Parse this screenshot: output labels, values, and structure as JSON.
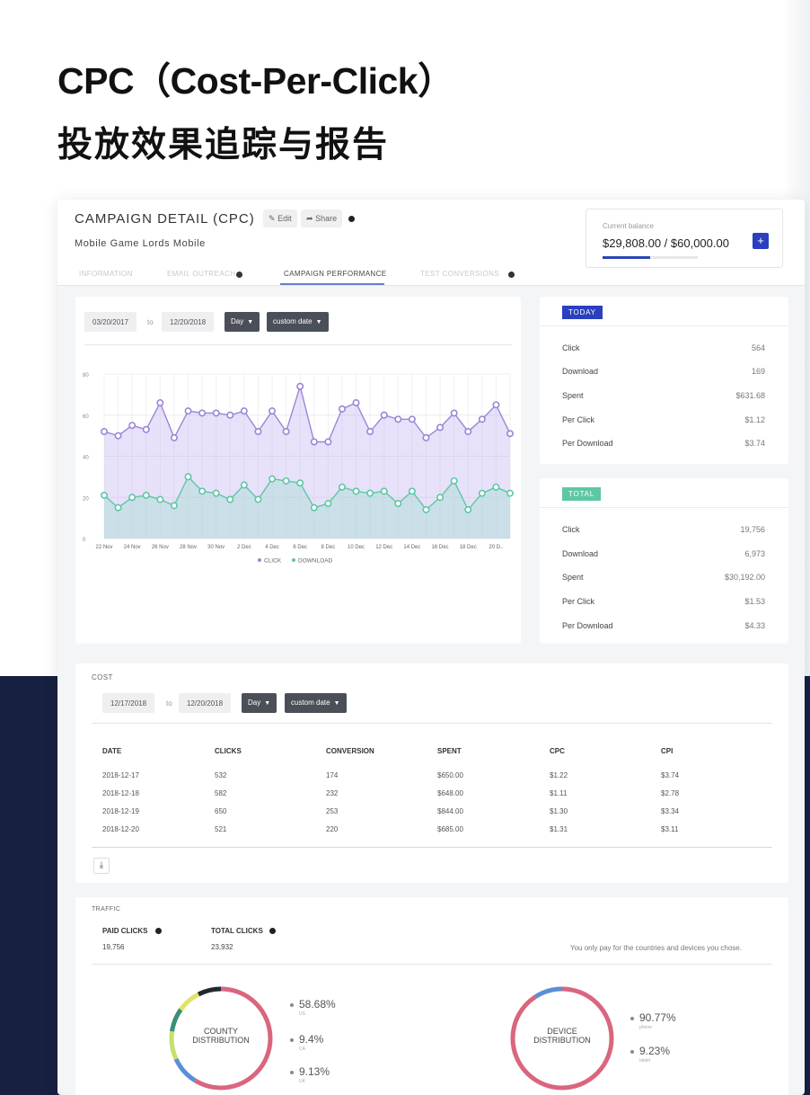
{
  "hero": {
    "title": "CPC（Cost-Per-Click）",
    "subtitle": "投放效果追踪与报告"
  },
  "campaign": {
    "title": "CAMPAIGN DETAIL (CPC)",
    "edit_label": "Edit",
    "share_label": "Share",
    "game_name": "Mobile Game Lords Mobile",
    "tabs": [
      "INFORMATION",
      "EMAIL OUTREACH",
      "CAMPAIGN PERFORMANCE",
      "TEST CONVERSIONS"
    ],
    "active_tab": "CAMPAIGN PERFORMANCE"
  },
  "balance": {
    "label": "Current balance",
    "value": "$29,808.00 / $60,000.00",
    "progress": 0.4968,
    "add_label": "+"
  },
  "performance": {
    "date_from": "03/20/2017",
    "to_label": "to",
    "date_to": "12/20/2018",
    "interval": "Day",
    "range": "custom date"
  },
  "chart_data": {
    "type": "line",
    "x": [
      "22 Nov",
      "",
      "24 Nov",
      "",
      "26 Nov",
      "",
      "28 Nov",
      "",
      "30 Nov",
      "",
      "2 Dec",
      "",
      "4 Dec",
      "",
      "6 Dec",
      "",
      "8 Dec",
      "",
      "10 Dec",
      "",
      "12 Dec",
      "",
      "14 Dec",
      "",
      "16 Dec",
      "",
      "18 Dec",
      "",
      "20 D..",
      ""
    ],
    "x_tick_labels": [
      "22 Nov",
      "24 Nov",
      "26 Nov",
      "28 Nov",
      "30 Nov",
      "2 Dec",
      "4 Dec",
      "6 Dec",
      "8 Dec",
      "10 Dec",
      "12 Dec",
      "14 Dec",
      "16 Dec",
      "18 Dec",
      "20 D.."
    ],
    "y_ticks": [
      0,
      20,
      40,
      60,
      80
    ],
    "ylim": [
      0,
      80
    ],
    "series": [
      {
        "name": "CLICK",
        "color": "#9b86d6",
        "values": [
          52,
          50,
          55,
          53,
          66,
          49,
          62,
          61,
          61,
          60,
          62,
          52,
          62,
          52,
          74,
          47,
          47,
          63,
          66,
          52,
          60,
          58,
          58,
          49,
          54,
          61,
          52,
          58,
          65,
          51
        ]
      },
      {
        "name": "DOWNLOAD",
        "color": "#5dc8a4",
        "values": [
          21,
          15,
          20,
          21,
          19,
          16,
          30,
          23,
          22,
          19,
          26,
          19,
          29,
          28,
          27,
          15,
          17,
          25,
          23,
          22,
          23,
          17,
          23,
          14,
          20,
          28,
          14,
          22,
          25,
          22
        ]
      }
    ],
    "legend_position": "bottom"
  },
  "today": {
    "badge": "TODAY",
    "badge_color": "#2b3fbf",
    "rows": [
      {
        "label": "Click",
        "value": "564"
      },
      {
        "label": "Download",
        "value": "169"
      },
      {
        "label": "Spent",
        "value": "$631.68"
      },
      {
        "label": "Per Click",
        "value": "$1.12"
      },
      {
        "label": "Per Download",
        "value": "$3.74"
      }
    ]
  },
  "total": {
    "badge": "TOTAL",
    "badge_color": "#5dc8a4",
    "rows": [
      {
        "label": "Click",
        "value": "19,756"
      },
      {
        "label": "Download",
        "value": "6,973"
      },
      {
        "label": "Spent",
        "value": "$30,192.00"
      },
      {
        "label": "Per Click",
        "value": "$1.53"
      },
      {
        "label": "Per Download",
        "value": "$4.33"
      }
    ]
  },
  "cost": {
    "label": "COST",
    "date_from": "12/17/2018",
    "to_label": "to",
    "date_to": "12/20/2018",
    "interval": "Day",
    "range": "custom date",
    "headers": [
      "DATE",
      "CLICKS",
      "CONVERSION",
      "SPENT",
      "CPC",
      "CPI"
    ],
    "rows": [
      [
        "2018-12-17",
        "532",
        "174",
        "$650.00",
        "$1.22",
        "$3.74"
      ],
      [
        "2018-12-18",
        "582",
        "232",
        "$648.00",
        "$1.11",
        "$2.78"
      ],
      [
        "2018-12-19",
        "650",
        "253",
        "$844.00",
        "$1.30",
        "$3.34"
      ],
      [
        "2018-12-20",
        "521",
        "220",
        "$685.00",
        "$1.31",
        "$3.11"
      ]
    ],
    "download_icon": "download-icon"
  },
  "traffic": {
    "label": "TRAFFIC",
    "paid_clicks_label": "PAID CLICKS",
    "paid_clicks_value": "19,756",
    "total_clicks_label": "TOTAL CLICKS",
    "total_clicks_value": "23,932",
    "note": "You only pay for the countries and devices you chose.",
    "country": {
      "label_line1": "COUNTY",
      "label_line2": "DISTRIBUTION",
      "items": [
        {
          "pct": "58.68%",
          "name": "US",
          "value": 58.68,
          "color": "#d9667e"
        },
        {
          "pct": "9.4%",
          "name": "CA",
          "value": 9.4,
          "color": "#5b8fd6"
        },
        {
          "pct": "9.13%",
          "name": "UK",
          "value": 9.13,
          "color": "#c7e06a"
        }
      ],
      "other_colors": [
        "#3a8f7a",
        "#e1e36a",
        "#222831"
      ]
    },
    "device": {
      "label_line1": "DEVICE",
      "label_line2": "DISTRIBUTION",
      "items": [
        {
          "pct": "90.77%",
          "name": "phone",
          "value": 90.77,
          "color": "#d9667e"
        },
        {
          "pct": "9.23%",
          "name": "tablet",
          "value": 9.23,
          "color": "#5b8fd6"
        }
      ]
    }
  }
}
